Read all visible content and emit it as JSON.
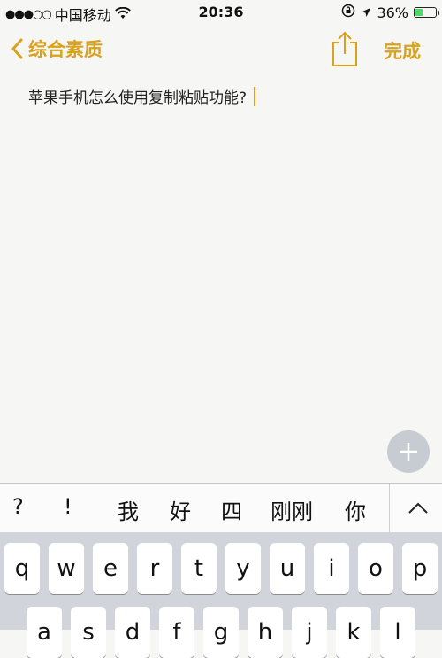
{
  "status_bar": {
    "signal": "●●●○○",
    "carrier": "中国移动",
    "time": "20:36",
    "battery_percent": "36%",
    "battery_level": 0.36,
    "icons": [
      "wifi-icon",
      "orientation-lock-icon",
      "location-icon",
      "battery-icon"
    ]
  },
  "navbar": {
    "back_label": "综合素质",
    "done_label": "完成",
    "accent_color": "#d8a21f"
  },
  "note": {
    "text": "苹果手机怎么使用复制粘贴功能?"
  },
  "candidates": [
    "?",
    "!",
    "我",
    "好",
    "四",
    "刚刚",
    "你"
  ],
  "keyboard": {
    "row1": [
      "q",
      "w",
      "e",
      "r",
      "t",
      "y",
      "u",
      "i",
      "o",
      "p"
    ],
    "row2": [
      "a",
      "s",
      "d",
      "f",
      "g",
      "h",
      "j",
      "k",
      "l"
    ]
  }
}
